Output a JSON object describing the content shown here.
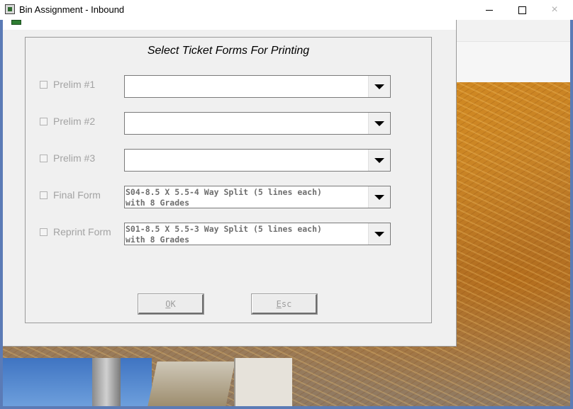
{
  "window": {
    "title": "Bin Assignment - Inbound",
    "minimize_glyph": "",
    "close_glyph": "×"
  },
  "dialog": {
    "heading": "Select Ticket Forms For Printing",
    "rows": [
      {
        "label": "Prelim #1",
        "checked": false,
        "value": ""
      },
      {
        "label": "Prelim #2",
        "checked": false,
        "value": ""
      },
      {
        "label": "Prelim #3",
        "checked": false,
        "value": ""
      },
      {
        "label": "Final Form",
        "checked": false,
        "value": "S04-8.5 X 5.5-4 Way Split (5 lines each)\nwith 8 Grades"
      },
      {
        "label": "Reprint Form",
        "checked": false,
        "value": "S01-8.5 X 5.5-3 Way Split (5 lines each)\nwith 8 Grades"
      }
    ],
    "ok_button": {
      "first": "O",
      "rest": "K"
    },
    "esc_button": {
      "first": "E",
      "rest": "sc"
    }
  },
  "colors": {
    "window_accent": "#5b7bb6",
    "dialog_bg": "#f0f0f0",
    "disabled_text": "#a3a3a3"
  },
  "icons": {
    "app": "app-icon",
    "dropdown": "chevron-down-icon",
    "checkbox": "checkbox-icon"
  }
}
